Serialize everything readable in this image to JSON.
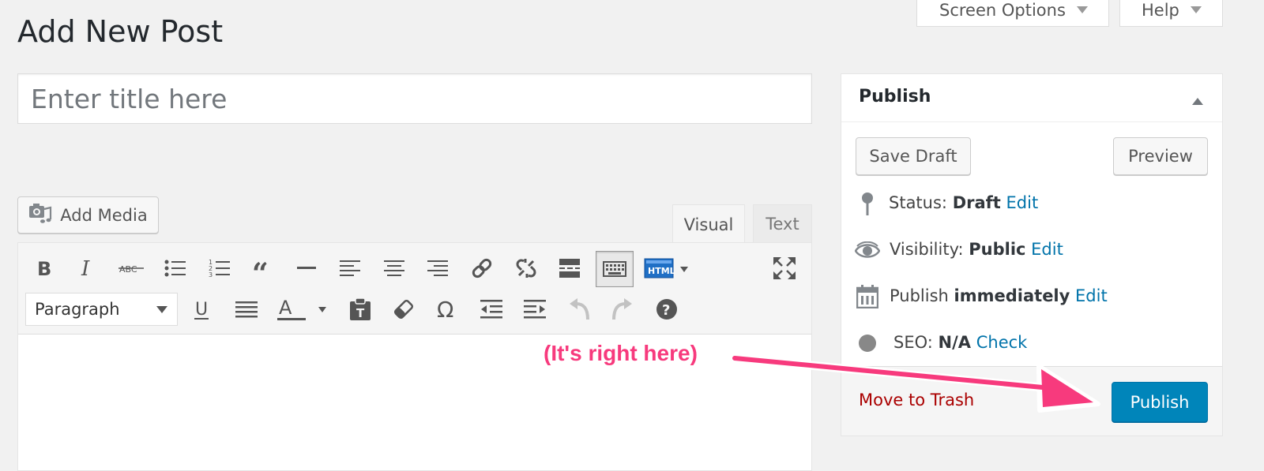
{
  "header": {
    "title": "Add New Post",
    "screen_options_label": "Screen Options",
    "help_label": "Help"
  },
  "title_field": {
    "placeholder": "Enter title here",
    "value": ""
  },
  "editor": {
    "add_media_label": "Add Media",
    "tabs": {
      "visual": "Visual",
      "text": "Text"
    },
    "format_select_value": "Paragraph",
    "toolbar_icons": [
      "bold-icon",
      "italic-icon",
      "strikethrough-icon",
      "bullet-list-icon",
      "numbered-list-icon",
      "blockquote-icon",
      "horizontal-rule-icon",
      "align-left-icon",
      "align-center-icon",
      "align-right-icon",
      "link-icon",
      "unlink-icon",
      "read-more-icon",
      "toolbar-toggle-icon",
      "html-icon",
      "fullscreen-icon",
      "underline-icon",
      "justify-icon",
      "text-color-icon",
      "paste-as-text-icon",
      "clear-formatting-icon",
      "special-character-icon",
      "outdent-icon",
      "indent-icon",
      "undo-icon",
      "redo-icon",
      "help-icon"
    ],
    "html_icon_text": "HTML"
  },
  "publish_box": {
    "title": "Publish",
    "save_draft_label": "Save Draft",
    "preview_label": "Preview",
    "status": {
      "label": "Status:",
      "value": "Draft",
      "action": "Edit"
    },
    "visibility": {
      "label": "Visibility:",
      "value": "Public",
      "action": "Edit"
    },
    "schedule": {
      "label": "Publish",
      "value": "immediately",
      "action": "Edit"
    },
    "seo": {
      "label": "SEO:",
      "value": "N/A",
      "action": "Check"
    },
    "trash_label": "Move to Trash",
    "publish_label": "Publish"
  },
  "annotation": {
    "text": "(It's right here)",
    "color": "#f73a7d"
  },
  "colors": {
    "link": "#0073aa",
    "primary_button": "#0085ba",
    "trash": "#aa0000"
  }
}
